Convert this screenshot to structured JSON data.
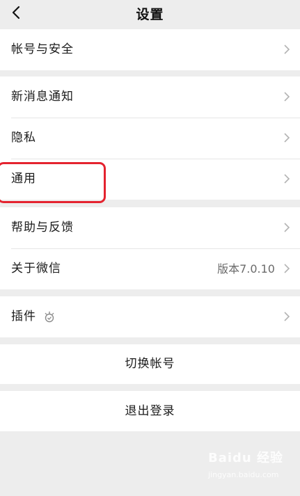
{
  "header": {
    "title": "设置",
    "back_icon": "chevron-left-icon"
  },
  "groups": [
    {
      "items": [
        {
          "label": "帐号与安全"
        }
      ]
    },
    {
      "items": [
        {
          "label": "新消息通知"
        },
        {
          "label": "隐私"
        },
        {
          "label": "通用"
        }
      ]
    },
    {
      "items": [
        {
          "label": "帮助与反馈"
        },
        {
          "label": "关于微信",
          "value": "版本7.0.10"
        }
      ]
    },
    {
      "items": [
        {
          "label": "插件",
          "icon": "plugin-icon"
        }
      ]
    }
  ],
  "actions": {
    "switch_account": "切换帐号",
    "logout": "退出登录"
  },
  "annotation": {
    "highlight_color": "#e4232f"
  },
  "watermark": {
    "text": "Baidu 经验",
    "sub": "jingyan.baidu.com"
  },
  "colors": {
    "background": "#ededed",
    "card": "#ffffff",
    "divider": "#e6e6e6",
    "chevron": "#b3b3b3"
  }
}
